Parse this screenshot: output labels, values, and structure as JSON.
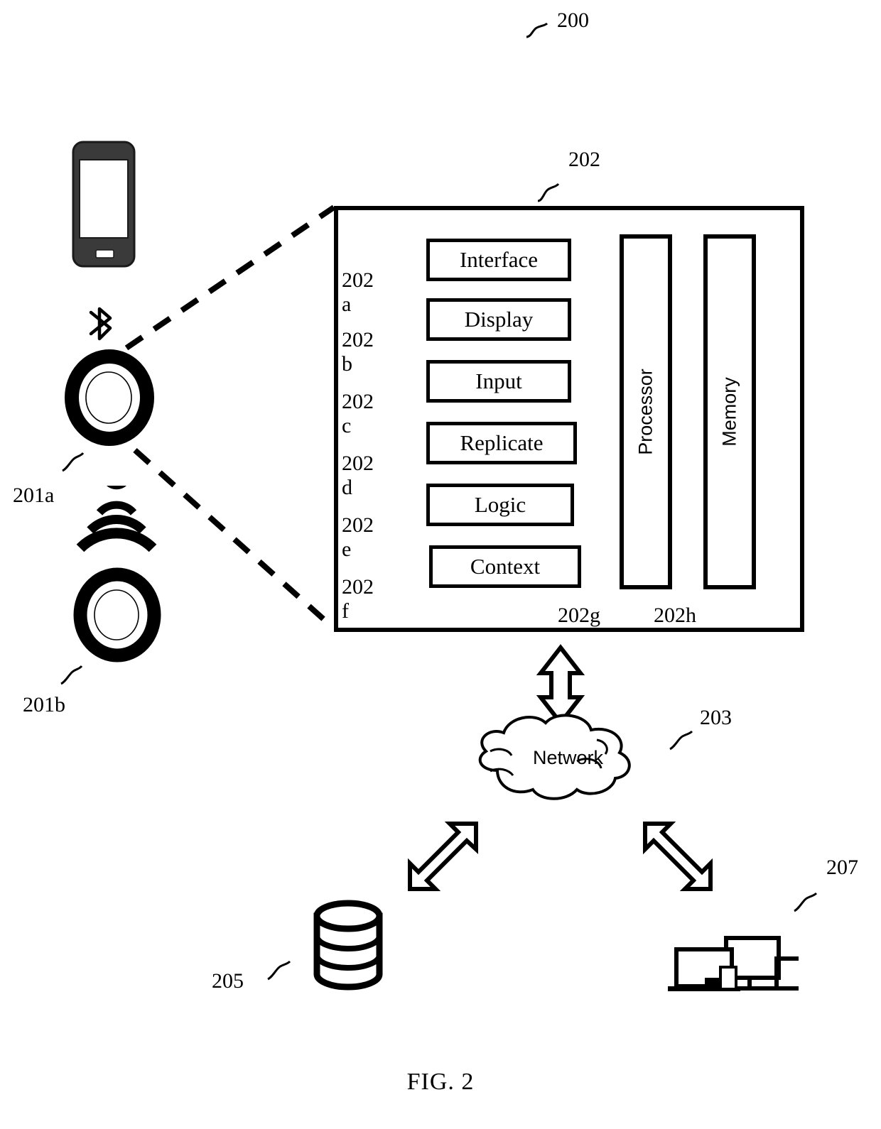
{
  "figure": {
    "caption": "FIG. 2",
    "system_ref": "200",
    "device_ref": "202",
    "network_ref": "203",
    "database_ref": "205",
    "clients_ref": "207",
    "wearable_a_ref": "201a",
    "wearable_b_ref": "201b",
    "processor_ref": "202g",
    "memory_ref": "202h"
  },
  "device": {
    "modules": [
      {
        "ref": "202a",
        "ref_line1": "202a",
        "ref_line2": "",
        "label": "Interface"
      },
      {
        "ref": "202b",
        "ref_line1": "202",
        "ref_line2": "b",
        "label": "Display"
      },
      {
        "ref": "202c",
        "ref_line1": "202",
        "ref_line2": "c",
        "label": "Input"
      },
      {
        "ref": "202d",
        "ref_line1": "202",
        "ref_line2": "d",
        "label": "Replicate"
      },
      {
        "ref": "202e",
        "ref_line1": "202",
        "ref_line2": "e",
        "label": "Logic"
      },
      {
        "ref": "202f",
        "ref_line1": "202",
        "ref_line2": "f",
        "label": "Context"
      }
    ],
    "columns": [
      {
        "ref": "202g",
        "label": "Processor"
      },
      {
        "ref": "202h",
        "label": "Memory"
      }
    ]
  },
  "network": {
    "label": "Network"
  },
  "icons": {
    "phone": "smartphone-icon",
    "bluetooth": "bluetooth-icon",
    "wireless": "wireless-signal-icon",
    "ring_a": "wearable-ring-icon",
    "ring_b": "wearable-ring-icon",
    "database": "database-cylinder-icon",
    "clients": "client-devices-icon",
    "cloud": "network-cloud-icon"
  }
}
